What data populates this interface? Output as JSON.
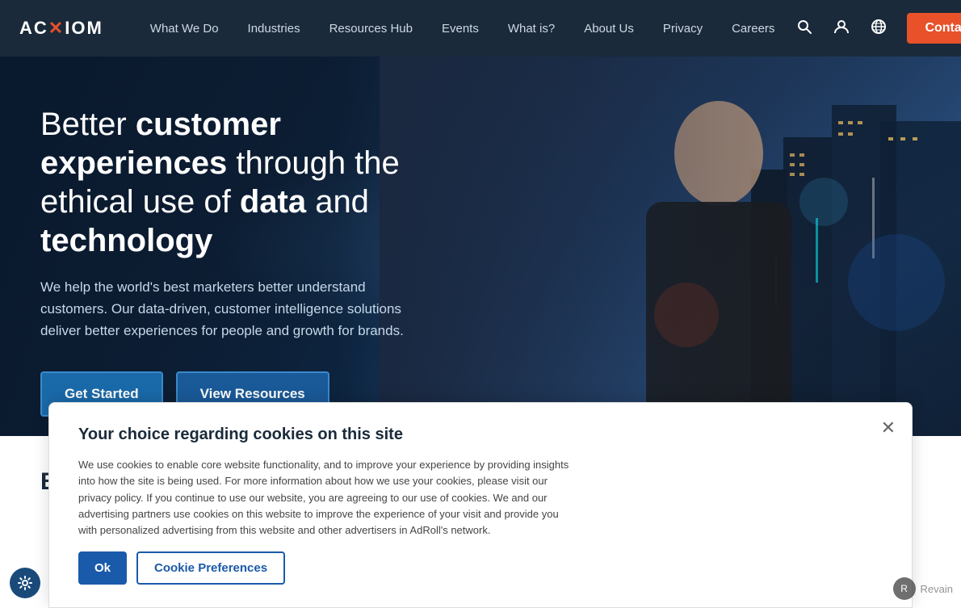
{
  "brand": {
    "logo_ac": "AC",
    "logo_x": "X",
    "logo_iom": "IOM"
  },
  "navbar": {
    "links": [
      {
        "label": "What We Do",
        "id": "what-we-do"
      },
      {
        "label": "Industries",
        "id": "industries"
      },
      {
        "label": "Resources Hub",
        "id": "resources-hub"
      },
      {
        "label": "Events",
        "id": "events"
      },
      {
        "label": "What is?",
        "id": "what-is"
      },
      {
        "label": "About Us",
        "id": "about-us"
      },
      {
        "label": "Privacy",
        "id": "privacy"
      },
      {
        "label": "Careers",
        "id": "careers"
      }
    ],
    "search_icon": "🔍",
    "user_icon": "👤",
    "globe_icon": "🌐",
    "contact_label": "Contact Us"
  },
  "hero": {
    "title_normal1": "Better ",
    "title_bold1": "customer experiences",
    "title_normal2": " through the ethical use of ",
    "title_bold2": "data",
    "title_normal3": " and ",
    "title_bold3": "technology",
    "description": "We help the world's best marketers better understand customers. Our data-driven, customer intelligence solutions deliver better experiences for people and growth for brands.",
    "btn_start": "Get Started",
    "btn_resources": "View Resources"
  },
  "below_fold": {
    "brands_title": "Brands who love people"
  },
  "cookie": {
    "title": "Your choice regarding cookies on this site",
    "text": "We use cookies to enable core website functionality, and to improve your experience by providing insights into how the site is being used. For more information about how we use your cookies, please visit our privacy policy. If you continue to use our website, you are agreeing to our use of cookies. We and our advertising partners use cookies on this website to improve the experience of your visit and provide you with personalized advertising from this website and other advertisers in AdRoll's network.",
    "ok_label": "Ok",
    "prefs_label": "Cookie Preferences",
    "close_icon": "✕"
  },
  "revain": {
    "text": "Revain"
  }
}
